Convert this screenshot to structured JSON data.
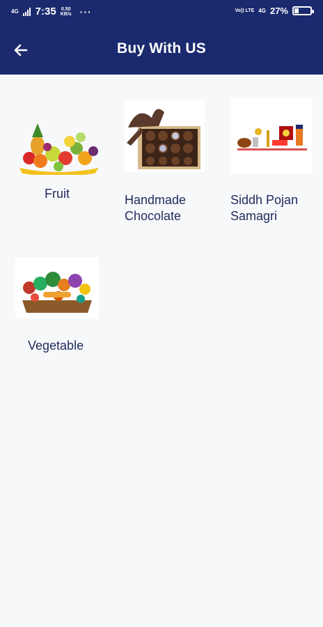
{
  "status_bar": {
    "network": "4G",
    "time": "7:35",
    "speed_value": "0.50",
    "speed_unit": "KB/s",
    "more": "···",
    "volte": "Vo)) LTE",
    "network_right": "4G",
    "battery_percent": "27%",
    "battery_level": 0.27
  },
  "app_bar": {
    "back_icon": "arrow-left-icon",
    "title": "Buy With US"
  },
  "categories": [
    {
      "label": "Fruit",
      "icon": "fruit-basket-image"
    },
    {
      "label": "Handmade Chocolate",
      "icon": "chocolate-box-image"
    },
    {
      "label": "Siddh Pojan Samagri",
      "icon": "puja-items-image"
    },
    {
      "label": "Vegetable",
      "icon": "vegetable-basket-image"
    }
  ],
  "colors": {
    "primary": "#1b2a6e",
    "background": "#f7f8fa",
    "text": "#1f2a5c"
  }
}
